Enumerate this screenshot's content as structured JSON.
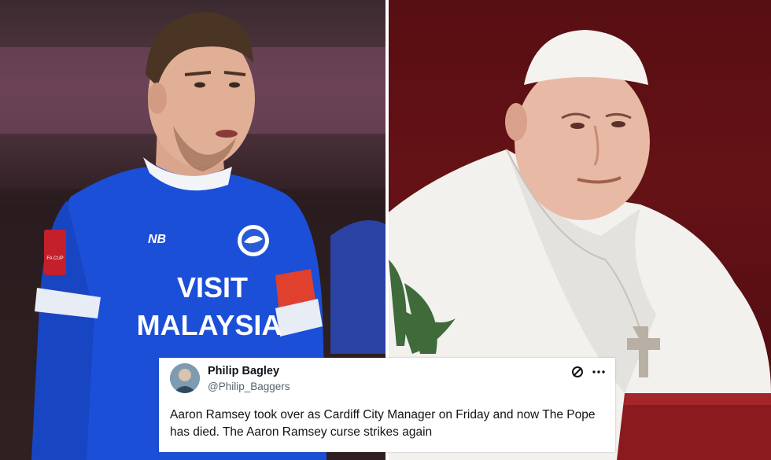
{
  "tweet": {
    "display_name": "Philip Bagley",
    "handle": "@Philip_Baggers",
    "text": "Aaron Ramsey took over as Cardiff City Manager on Friday and now The Pope has died. The Aaron Ramsey curse strikes again",
    "icons": [
      "grok-icon",
      "more-options-icon"
    ]
  },
  "left_photo": {
    "shirt_text_line1": "VISIT",
    "shirt_text_line2": "MALAYSIA",
    "shirt_brand": "NB",
    "sleeve_badge": "EMIRATES FA CUP"
  },
  "colors": {
    "shirt_blue": "#1b4fd8",
    "armband": "#e0402e",
    "background_red": "#6e1418",
    "vestment_white": "#f2f1ee"
  }
}
